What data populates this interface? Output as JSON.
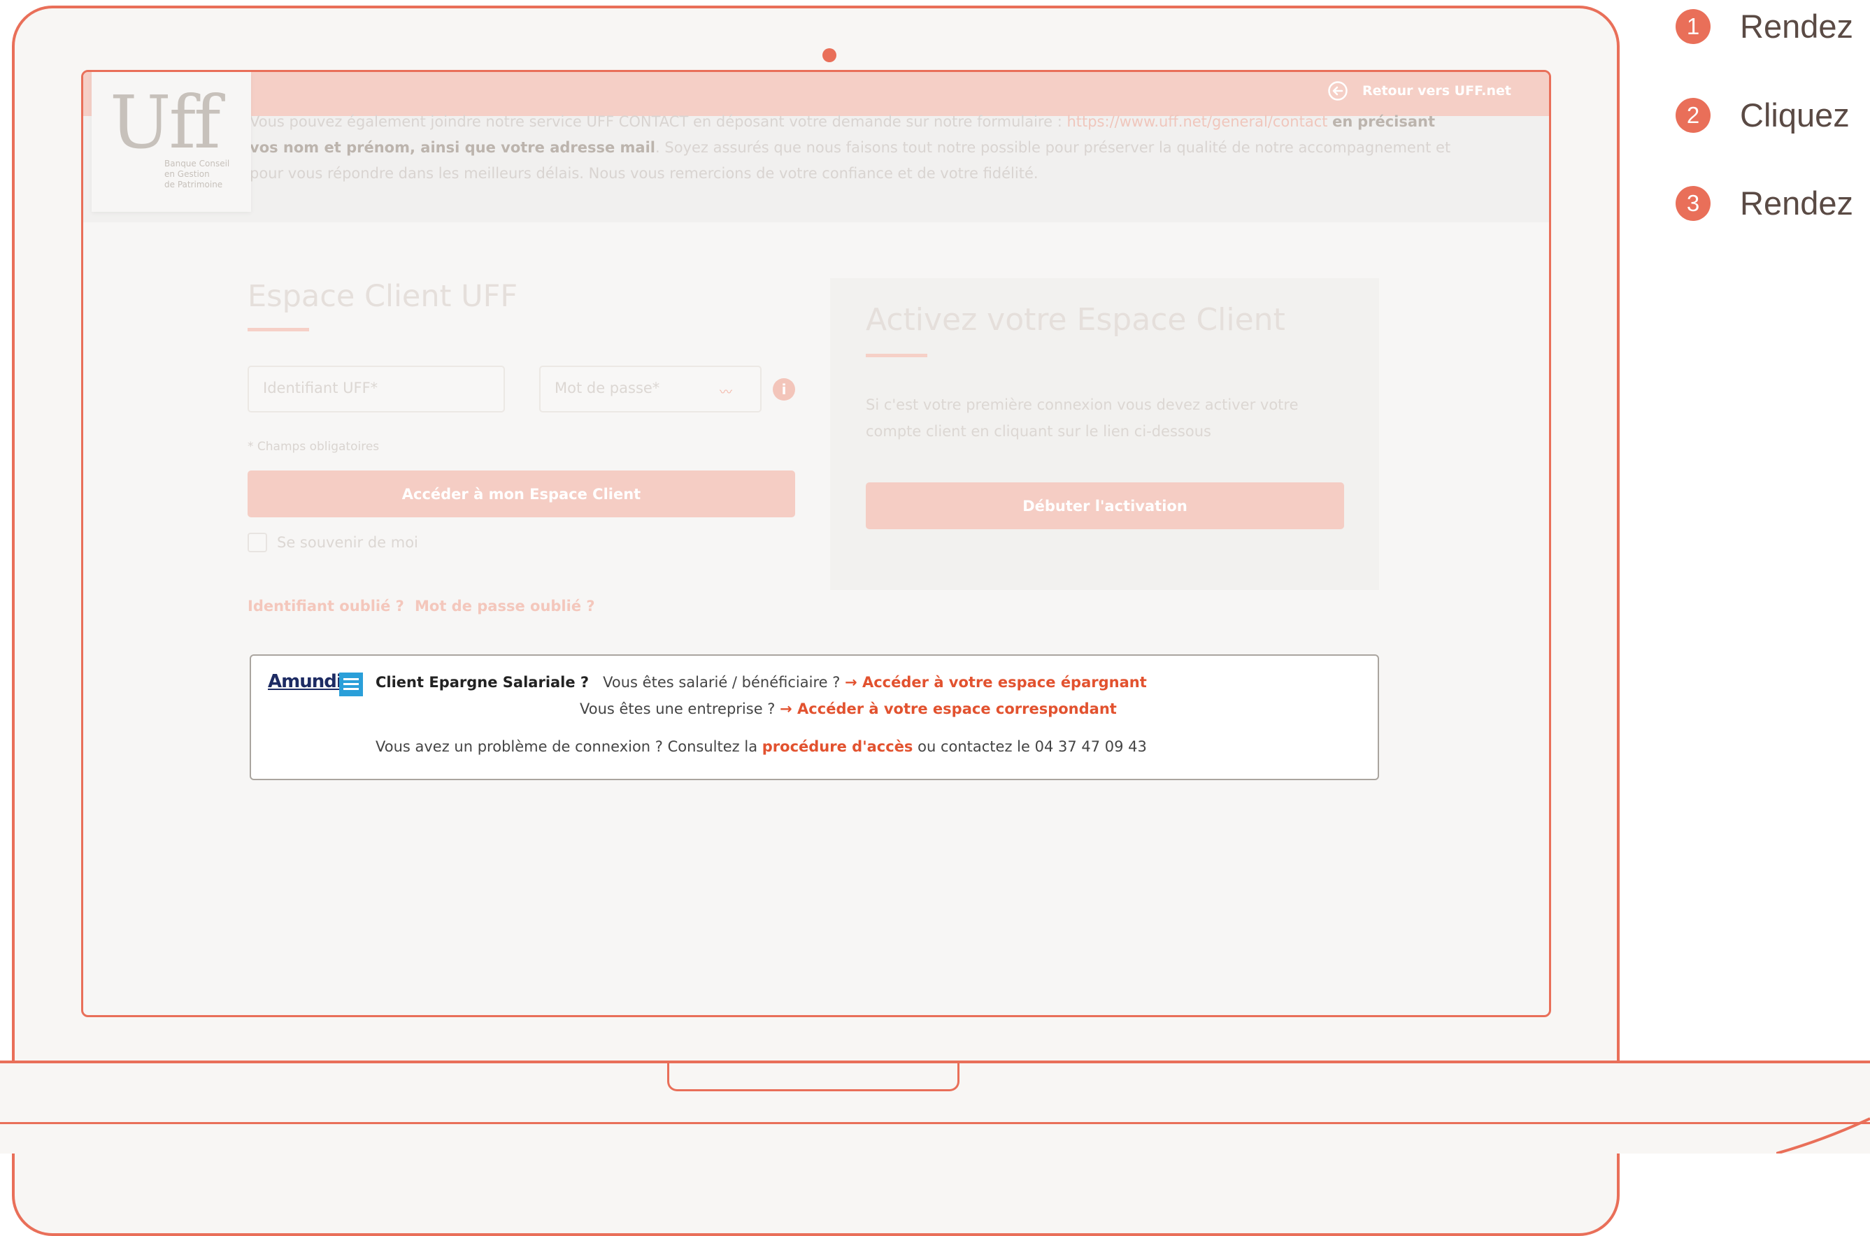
{
  "header": {
    "retour_label": "Retour vers UFF.net"
  },
  "logo": {
    "word": "Uff",
    "tagline_1": "Banque Conseil",
    "tagline_2": "en Gestion",
    "tagline_3": "de Patrimoine"
  },
  "notice": {
    "line1": "Vous pouvez également joindre notre service UFF CONTACT en déposant votre demande sur notre formulaire : ",
    "link": "https://www.uff.net/general/contact",
    "bold_prefix": "en",
    "bold": "précisant vos nom et prénom, ainsi que votre adresse mail",
    "rest": ". Soyez assurés que nous faisons tout notre possible pour préserver la qualité de notre accompagnement et pour vous répondre dans les meilleurs délais. Nous vous remercions de votre confiance et de votre fidélité."
  },
  "login": {
    "title": "Espace Client UFF",
    "id_placeholder": "Identifiant UFF*",
    "pw_placeholder": "Mot de passe*",
    "required_note": "* Champs obligatoires",
    "submit_label": "Accéder à mon Espace Client",
    "remember_label": "Se souvenir de moi",
    "forgot_id": "Identifiant oublié ?",
    "forgot_pw": "Mot de passe oublié ?"
  },
  "activation": {
    "title": "Activez votre Espace Client",
    "text": "Si c'est votre première connexion vous devez activer votre compte client en cliquant sur le lien ci-dessous",
    "button_label": "Débuter l'activation"
  },
  "amundi": {
    "logo": "Amundi",
    "epargne_label": "Client Epargne Salariale ?",
    "q1": "Vous êtes salarié / bénéficiaire ?",
    "link1": "→ Accéder à votre espace épargnant",
    "q2": "Vous êtes une entreprise ?",
    "link2": "→ Accéder à votre espace correspondant",
    "problem": "Vous avez un problème de connexion ? Consultez la",
    "procedure": "procédure d'accès",
    "contact": "ou contactez le 04 37 47 09 43"
  },
  "steps": [
    {
      "number": "1",
      "text": "Rendez"
    },
    {
      "number": "2",
      "text": "Cliquez"
    },
    {
      "number": "3",
      "text": "Rendez"
    }
  ],
  "colors": {
    "accent": "#e96f59",
    "link_orange": "#e2522f",
    "amundi_blue": "#1d2b63"
  }
}
